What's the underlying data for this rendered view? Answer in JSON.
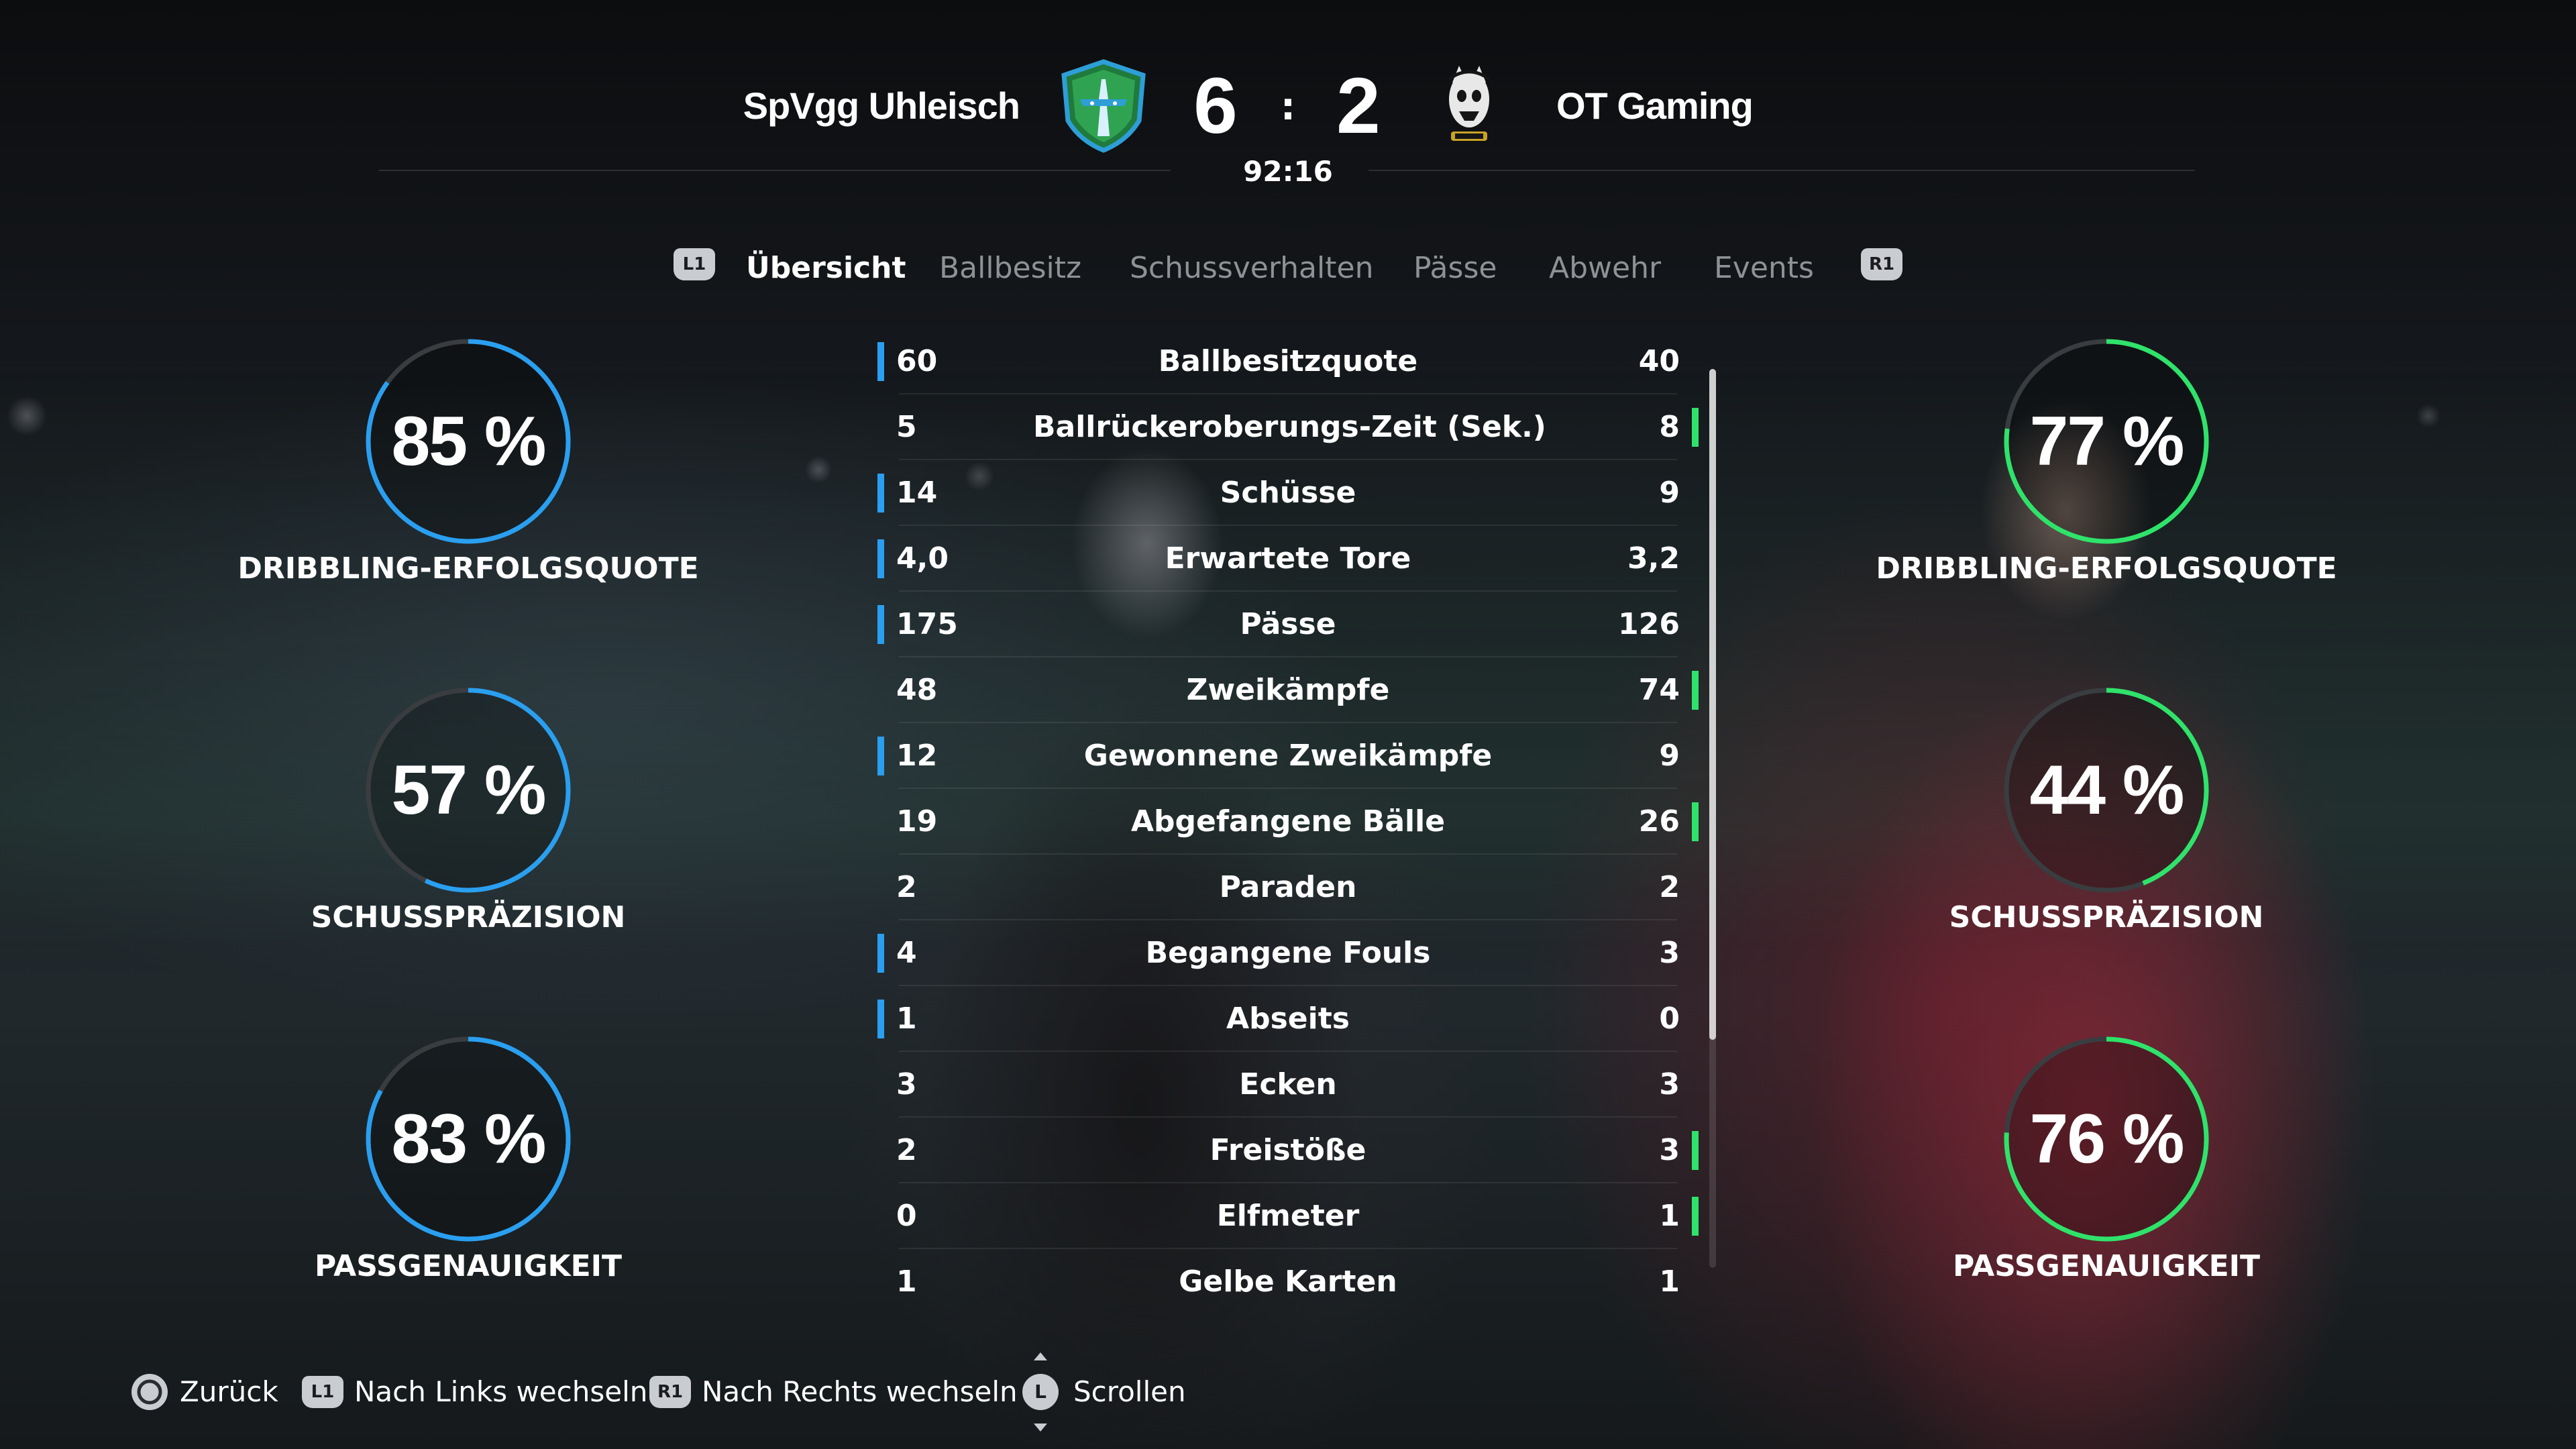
{
  "match": {
    "home_team": "SpVgg Uhleisch",
    "away_team": "OT Gaming",
    "home_score": "6",
    "away_score": "2",
    "separator": ":",
    "clock": "92:16"
  },
  "tabs": {
    "left_button": "L1",
    "right_button": "R1",
    "items": [
      {
        "label": "Übersicht",
        "active": true
      },
      {
        "label": "Ballbesitz",
        "active": false
      },
      {
        "label": "Schussverhalten",
        "active": false
      },
      {
        "label": "Pässe",
        "active": false
      },
      {
        "label": "Abwehr",
        "active": false
      },
      {
        "label": "Events",
        "active": false
      }
    ]
  },
  "home_rings": [
    {
      "value": "85 %",
      "fraction": 0.85,
      "label": "DRIBBLING-ERFOLGSQUOTE"
    },
    {
      "value": "57 %",
      "fraction": 0.57,
      "label": "SCHUSSPRÄZISION"
    },
    {
      "value": "83 %",
      "fraction": 0.83,
      "label": "PASSGENAUIGKEIT"
    }
  ],
  "away_rings": [
    {
      "value": "77 %",
      "fraction": 0.77,
      "label": "DRIBBLING-ERFOLGSQUOTE"
    },
    {
      "value": "44 %",
      "fraction": 0.44,
      "label": "SCHUSSPRÄZISION"
    },
    {
      "value": "76 %",
      "fraction": 0.76,
      "label": "PASSGENAUIGKEIT"
    }
  ],
  "stats": [
    {
      "name": "Ballbesitzquote",
      "home": "60",
      "away": "40",
      "leader": "home"
    },
    {
      "name": "Ballrückeroberungs-Zeit (Sek.)",
      "home": "5",
      "away": "8",
      "leader": "away"
    },
    {
      "name": "Schüsse",
      "home": "14",
      "away": "9",
      "leader": "home"
    },
    {
      "name": "Erwartete Tore",
      "home": "4,0",
      "away": "3,2",
      "leader": "home"
    },
    {
      "name": "Pässe",
      "home": "175",
      "away": "126",
      "leader": "home"
    },
    {
      "name": "Zweikämpfe",
      "home": "48",
      "away": "74",
      "leader": "away"
    },
    {
      "name": "Gewonnene Zweikämpfe",
      "home": "12",
      "away": "9",
      "leader": "home"
    },
    {
      "name": "Abgefangene Bälle",
      "home": "19",
      "away": "26",
      "leader": "away"
    },
    {
      "name": "Paraden",
      "home": "2",
      "away": "2",
      "leader": "none"
    },
    {
      "name": "Begangene Fouls",
      "home": "4",
      "away": "3",
      "leader": "home"
    },
    {
      "name": "Abseits",
      "home": "1",
      "away": "0",
      "leader": "home"
    },
    {
      "name": "Ecken",
      "home": "3",
      "away": "3",
      "leader": "none"
    },
    {
      "name": "Freistöße",
      "home": "2",
      "away": "3",
      "leader": "away"
    },
    {
      "name": "Elfmeter",
      "home": "0",
      "away": "1",
      "leader": "away"
    },
    {
      "name": "Gelbe Karten",
      "home": "1",
      "away": "1",
      "leader": "none"
    }
  ],
  "colors": {
    "home_accent": "#2a9ff0",
    "away_accent": "#2fe36a",
    "ring_track": "#3a3d40"
  },
  "footer": {
    "back_icon": "circle-button-icon",
    "back": "Zurück",
    "left_button": "L1",
    "left": "Nach Links wechseln",
    "right_button": "R1",
    "right": "Nach Rechts wechseln",
    "scroll_button": "L",
    "scroll": "Scrollen"
  }
}
